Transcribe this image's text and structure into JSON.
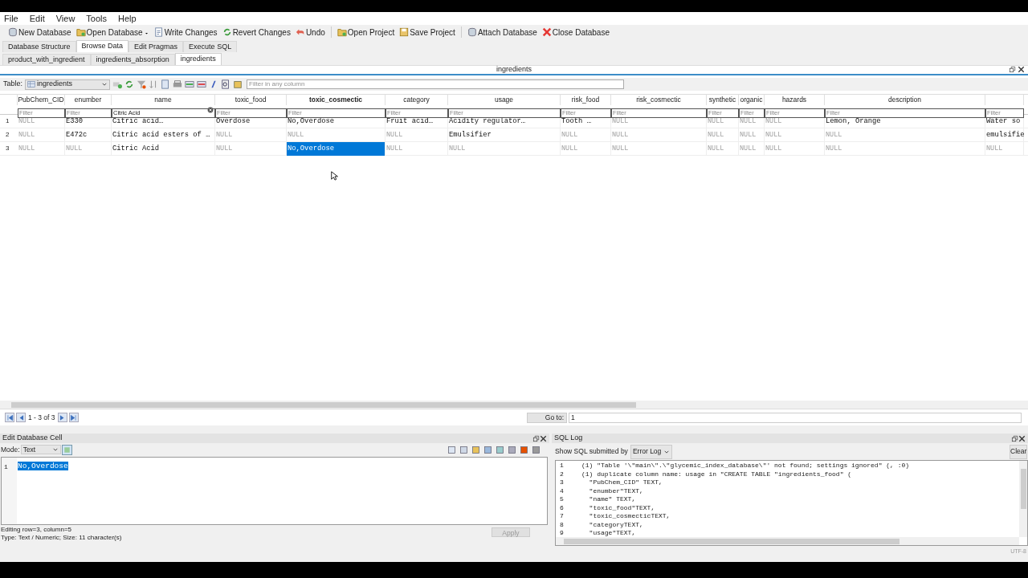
{
  "menu": [
    "File",
    "Edit",
    "View",
    "Tools",
    "Help"
  ],
  "toolbar": [
    {
      "label": "New Database",
      "dropdown": false
    },
    {
      "label": "Open Database",
      "dropdown": true
    },
    {
      "label": "Write Changes",
      "dropdown": false
    },
    {
      "label": "Revert Changes",
      "dropdown": false
    },
    {
      "label": "Undo",
      "dropdown": false
    },
    {
      "label": "Open Project",
      "dropdown": false
    },
    {
      "label": "Save Project",
      "dropdown": false
    },
    {
      "label": "Attach Database",
      "dropdown": false
    },
    {
      "label": "Close Database",
      "dropdown": false
    }
  ],
  "main_tabs": [
    {
      "label": "Database Structure",
      "selected": false
    },
    {
      "label": "Browse Data",
      "selected": true
    },
    {
      "label": "Edit Pragmas",
      "selected": false
    },
    {
      "label": "Execute SQL",
      "selected": false
    }
  ],
  "sub_tabs": [
    {
      "label": "product_with_ingredient",
      "selected": false
    },
    {
      "label": "ingredients_absorption",
      "selected": false
    },
    {
      "label": "ingredients",
      "selected": true
    }
  ],
  "pane_title": "ingredients",
  "table_bar": {
    "label": "Table:",
    "table": "ingredients",
    "filter_placeholder": "Filter in any column"
  },
  "grid": {
    "columns": [
      {
        "label": "PubChem_CID",
        "filter_placeholder": "Filter",
        "current": false
      },
      {
        "label": "enumber",
        "filter_placeholder": "Filter",
        "current": false
      },
      {
        "label": "name",
        "filter": "Citric Acid",
        "current": false
      },
      {
        "label": "toxic_food",
        "filter_placeholder": "Filter",
        "current": false
      },
      {
        "label": "toxic_cosmectic",
        "filter_placeholder": "Filter",
        "current": true
      },
      {
        "label": "category",
        "filter_placeholder": "Filter",
        "current": false
      },
      {
        "label": "usage",
        "filter_placeholder": "Filter",
        "current": false
      },
      {
        "label": "risk_food",
        "filter_placeholder": "Filter",
        "current": false
      },
      {
        "label": "risk_cosmectic",
        "filter_placeholder": "Filter",
        "current": false
      },
      {
        "label": "synthetic",
        "filter_placeholder": "Filter",
        "current": false
      },
      {
        "label": "organic",
        "filter_placeholder": "Filter",
        "current": false
      },
      {
        "label": "hazards",
        "filter_placeholder": "Filter",
        "current": false
      },
      {
        "label": "description",
        "filter_placeholder": "Filter",
        "current": false
      },
      {
        "filter_placeholder": "Filter"
      }
    ],
    "rows": [
      {
        "number": "1",
        "cells": [
          {
            "text": "NULL",
            "is_null": true,
            "selected": false
          },
          {
            "text": "E330",
            "is_null": false,
            "selected": false
          },
          {
            "text": "Citric acid…",
            "is_null": false,
            "selected": false
          },
          {
            "text": "Overdose",
            "is_null": false,
            "selected": false
          },
          {
            "text": "No,Overdose",
            "is_null": false,
            "selected": false
          },
          {
            "text": "Fruit acid…",
            "is_null": false,
            "selected": false
          },
          {
            "text": "Acidity regulator…",
            "is_null": false,
            "selected": false
          },
          {
            "text": "Tooth …",
            "is_null": false,
            "selected": false
          },
          {
            "text": "NULL",
            "is_null": true,
            "selected": false
          },
          {
            "text": "NULL",
            "is_null": true,
            "selected": false
          },
          {
            "text": "NULL",
            "is_null": true,
            "selected": false
          },
          {
            "text": "NULL",
            "is_null": true,
            "selected": false
          },
          {
            "text": "Lemon, Orange",
            "is_null": false,
            "selected": false
          },
          {
            "text": "Water so",
            "is_null": false,
            "selected": false
          }
        ]
      },
      {
        "number": "2",
        "cells": [
          {
            "text": "NULL",
            "is_null": true,
            "selected": false
          },
          {
            "text": "E472c",
            "is_null": false,
            "selected": false
          },
          {
            "text": "Citric acid esters of …",
            "is_null": false,
            "selected": false
          },
          {
            "text": "NULL",
            "is_null": true,
            "selected": false
          },
          {
            "text": "NULL",
            "is_null": true,
            "selected": false
          },
          {
            "text": "NULL",
            "is_null": true,
            "selected": false
          },
          {
            "text": "Emulsifier",
            "is_null": false,
            "selected": false
          },
          {
            "text": "NULL",
            "is_null": true,
            "selected": false
          },
          {
            "text": "NULL",
            "is_null": true,
            "selected": false
          },
          {
            "text": "NULL",
            "is_null": true,
            "selected": false
          },
          {
            "text": "NULL",
            "is_null": true,
            "selected": false
          },
          {
            "text": "NULL",
            "is_null": true,
            "selected": false
          },
          {
            "text": "NULL",
            "is_null": true,
            "selected": false
          },
          {
            "text": "emulsifie",
            "is_null": false,
            "selected": false
          }
        ]
      },
      {
        "number": "3",
        "cells": [
          {
            "text": "NULL",
            "is_null": true,
            "selected": false
          },
          {
            "text": "NULL",
            "is_null": true,
            "selected": false
          },
          {
            "text": "Citric Acid",
            "is_null": false,
            "selected": false
          },
          {
            "text": "NULL",
            "is_null": true,
            "selected": false
          },
          {
            "text": "No,Overdose",
            "is_null": false,
            "selected": true
          },
          {
            "text": "NULL",
            "is_null": true,
            "selected": false
          },
          {
            "text": "NULL",
            "is_null": true,
            "selected": false
          },
          {
            "text": "NULL",
            "is_null": true,
            "selected": false
          },
          {
            "text": "NULL",
            "is_null": true,
            "selected": false
          },
          {
            "text": "NULL",
            "is_null": true,
            "selected": false
          },
          {
            "text": "NULL",
            "is_null": true,
            "selected": false
          },
          {
            "text": "NULL",
            "is_null": true,
            "selected": false
          },
          {
            "text": "NULL",
            "is_null": true,
            "selected": false
          },
          {
            "text": "NULL",
            "is_null": true,
            "selected": false
          }
        ]
      }
    ]
  },
  "nav": {
    "range": "1 - 3 of 3",
    "goto_label": "Go to:",
    "goto_value": "1"
  },
  "edit_cell": {
    "title": "Edit Database Cell",
    "mode_label": "Mode:",
    "mode": "Text",
    "line_number": "1",
    "value": "No,Overdose",
    "value_selected": true,
    "status": [
      "Editing row=3, column=5",
      "Type: Text / Numeric; Size: 11 character(s)"
    ],
    "apply": "Apply",
    "apply_disabled": true
  },
  "sql_log": {
    "title": "SQL Log",
    "filter_label": "Show SQL submitted by",
    "filter": "Error Log",
    "clear": "Clear",
    "lines": [
      {
        "number": "1",
        "text": "(1) \"Table '\\\"main\\\".\\\"glycemic_index_database\\\"' not found; settings ignored\" (, :0)"
      },
      {
        "number": "2",
        "text": "(1) duplicate column name: usage in \"CREATE TABLE \"ingredients_food\" ("
      },
      {
        "number": "3",
        "text": "  \"PubChem_CID\" TEXT,"
      },
      {
        "number": "4",
        "text": "  \"enumber\"TEXT,"
      },
      {
        "number": "5",
        "text": "  \"name\" TEXT,"
      },
      {
        "number": "6",
        "text": "  \"toxic_food\"TEXT,"
      },
      {
        "number": "7",
        "text": "  \"toxic_cosmecticTEXT,"
      },
      {
        "number": "8",
        "text": "  \"categoryTEXT,"
      },
      {
        "number": "9",
        "text": "  \"usage\"TEXT,"
      }
    ]
  },
  "status_bar": {
    "encoding": "UTF-8"
  }
}
